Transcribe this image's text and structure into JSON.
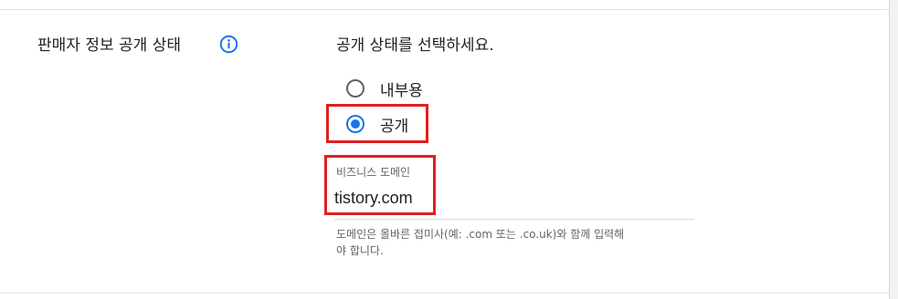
{
  "section": {
    "label": "판매자 정보 공개 상태",
    "info_icon": "info-icon"
  },
  "visibility": {
    "prompt": "공개 상태를 선택하세요.",
    "options": [
      {
        "label": "내부용",
        "checked": false
      },
      {
        "label": "공개",
        "checked": true
      }
    ]
  },
  "domain_field": {
    "label": "비즈니스 도메인",
    "value": "tistory.com",
    "helper_line1": "도메인은 올바른 접미사(예: .com 또는 .co.uk)와 함께 입력해",
    "helper_line2": "야 합니다."
  },
  "colors": {
    "accent": "#1a73e8",
    "highlight": "#e0201f",
    "text": "#202124",
    "secondary_text": "#5f6368"
  }
}
